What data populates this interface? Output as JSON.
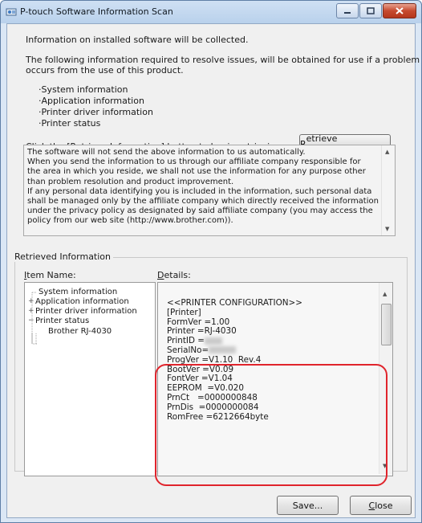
{
  "window": {
    "title": "P-touch Software Information Scan"
  },
  "intro": {
    "line1": "Information on installed software will be collected.",
    "line2a": "The following information required to resolve issues, will be obtained for use if a problem",
    "line2b": "occurs from the use of this product.",
    "bullets": [
      "·System information",
      "·Application information",
      "·Printer driver information",
      "·Printer status"
    ],
    "instruction": "Click the [Retrieve Information] button to begin retrieving."
  },
  "buttons": {
    "retrieve": {
      "mnemonic": "R",
      "rest": "etrieve Information"
    },
    "save": "Save...",
    "close": {
      "mnemonic": "C",
      "rest": "lose"
    }
  },
  "notice": {
    "lines": [
      "The software will not send the above information to us automatically.",
      "When you send the information to us through our affiliate company responsible for",
      "the area in which you reside, we shall not use the information for any purpose other",
      "than problem resolution and product improvement.",
      "If any personal data identifying you is included in the information, such personal data",
      "shall be managed only by the affiliate company which directly received the information",
      "under the privacy policy as designated by said affiliate company (you may access the",
      "policy from our web site (http://www.brother.com))."
    ]
  },
  "retrieved": {
    "group_label": "Retrieved Information",
    "item_name_label": {
      "mnemonic": "I",
      "rest": "tem Name:"
    },
    "details_label": {
      "mnemonic": "D",
      "rest": "etails:"
    },
    "tree": [
      {
        "label": "System information",
        "expander": ""
      },
      {
        "label": "Application information",
        "expander": "+"
      },
      {
        "label": "Printer driver information",
        "expander": "+"
      },
      {
        "label": "Printer status",
        "expander": "−"
      },
      {
        "label": "Brother RJ-4030",
        "expander": ""
      }
    ],
    "details_lines": [
      "<<PRINTER CONFIGURATION>>",
      "[Printer]",
      "FormVer =1.00",
      "Printer =RJ-4030",
      "PrintID =",
      "SerialNo=",
      "ProgVer =V1.10  Rev.4",
      "BootVer =V0.09",
      "FontVer =V1.04",
      "EEPROM  =V0.020",
      "PrnCt   =0000000848",
      "PrnDis  =0000000084",
      "RomFree =6212664byte"
    ]
  },
  "colors": {
    "highlight": "#e0242c",
    "close_button": "#c64a2f"
  }
}
